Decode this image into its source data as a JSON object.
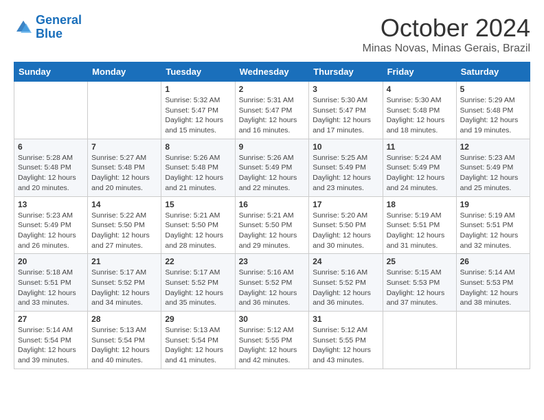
{
  "logo": {
    "line1": "General",
    "line2": "Blue"
  },
  "title": "October 2024",
  "subtitle": "Minas Novas, Minas Gerais, Brazil",
  "headers": [
    "Sunday",
    "Monday",
    "Tuesday",
    "Wednesday",
    "Thursday",
    "Friday",
    "Saturday"
  ],
  "weeks": [
    [
      {
        "day": "",
        "sunrise": "",
        "sunset": "",
        "daylight": ""
      },
      {
        "day": "",
        "sunrise": "",
        "sunset": "",
        "daylight": ""
      },
      {
        "day": "1",
        "sunrise": "Sunrise: 5:32 AM",
        "sunset": "Sunset: 5:47 PM",
        "daylight": "Daylight: 12 hours and 15 minutes."
      },
      {
        "day": "2",
        "sunrise": "Sunrise: 5:31 AM",
        "sunset": "Sunset: 5:47 PM",
        "daylight": "Daylight: 12 hours and 16 minutes."
      },
      {
        "day": "3",
        "sunrise": "Sunrise: 5:30 AM",
        "sunset": "Sunset: 5:47 PM",
        "daylight": "Daylight: 12 hours and 17 minutes."
      },
      {
        "day": "4",
        "sunrise": "Sunrise: 5:30 AM",
        "sunset": "Sunset: 5:48 PM",
        "daylight": "Daylight: 12 hours and 18 minutes."
      },
      {
        "day": "5",
        "sunrise": "Sunrise: 5:29 AM",
        "sunset": "Sunset: 5:48 PM",
        "daylight": "Daylight: 12 hours and 19 minutes."
      }
    ],
    [
      {
        "day": "6",
        "sunrise": "Sunrise: 5:28 AM",
        "sunset": "Sunset: 5:48 PM",
        "daylight": "Daylight: 12 hours and 20 minutes."
      },
      {
        "day": "7",
        "sunrise": "Sunrise: 5:27 AM",
        "sunset": "Sunset: 5:48 PM",
        "daylight": "Daylight: 12 hours and 20 minutes."
      },
      {
        "day": "8",
        "sunrise": "Sunrise: 5:26 AM",
        "sunset": "Sunset: 5:48 PM",
        "daylight": "Daylight: 12 hours and 21 minutes."
      },
      {
        "day": "9",
        "sunrise": "Sunrise: 5:26 AM",
        "sunset": "Sunset: 5:49 PM",
        "daylight": "Daylight: 12 hours and 22 minutes."
      },
      {
        "day": "10",
        "sunrise": "Sunrise: 5:25 AM",
        "sunset": "Sunset: 5:49 PM",
        "daylight": "Daylight: 12 hours and 23 minutes."
      },
      {
        "day": "11",
        "sunrise": "Sunrise: 5:24 AM",
        "sunset": "Sunset: 5:49 PM",
        "daylight": "Daylight: 12 hours and 24 minutes."
      },
      {
        "day": "12",
        "sunrise": "Sunrise: 5:23 AM",
        "sunset": "Sunset: 5:49 PM",
        "daylight": "Daylight: 12 hours and 25 minutes."
      }
    ],
    [
      {
        "day": "13",
        "sunrise": "Sunrise: 5:23 AM",
        "sunset": "Sunset: 5:49 PM",
        "daylight": "Daylight: 12 hours and 26 minutes."
      },
      {
        "day": "14",
        "sunrise": "Sunrise: 5:22 AM",
        "sunset": "Sunset: 5:50 PM",
        "daylight": "Daylight: 12 hours and 27 minutes."
      },
      {
        "day": "15",
        "sunrise": "Sunrise: 5:21 AM",
        "sunset": "Sunset: 5:50 PM",
        "daylight": "Daylight: 12 hours and 28 minutes."
      },
      {
        "day": "16",
        "sunrise": "Sunrise: 5:21 AM",
        "sunset": "Sunset: 5:50 PM",
        "daylight": "Daylight: 12 hours and 29 minutes."
      },
      {
        "day": "17",
        "sunrise": "Sunrise: 5:20 AM",
        "sunset": "Sunset: 5:50 PM",
        "daylight": "Daylight: 12 hours and 30 minutes."
      },
      {
        "day": "18",
        "sunrise": "Sunrise: 5:19 AM",
        "sunset": "Sunset: 5:51 PM",
        "daylight": "Daylight: 12 hours and 31 minutes."
      },
      {
        "day": "19",
        "sunrise": "Sunrise: 5:19 AM",
        "sunset": "Sunset: 5:51 PM",
        "daylight": "Daylight: 12 hours and 32 minutes."
      }
    ],
    [
      {
        "day": "20",
        "sunrise": "Sunrise: 5:18 AM",
        "sunset": "Sunset: 5:51 PM",
        "daylight": "Daylight: 12 hours and 33 minutes."
      },
      {
        "day": "21",
        "sunrise": "Sunrise: 5:17 AM",
        "sunset": "Sunset: 5:52 PM",
        "daylight": "Daylight: 12 hours and 34 minutes."
      },
      {
        "day": "22",
        "sunrise": "Sunrise: 5:17 AM",
        "sunset": "Sunset: 5:52 PM",
        "daylight": "Daylight: 12 hours and 35 minutes."
      },
      {
        "day": "23",
        "sunrise": "Sunrise: 5:16 AM",
        "sunset": "Sunset: 5:52 PM",
        "daylight": "Daylight: 12 hours and 36 minutes."
      },
      {
        "day": "24",
        "sunrise": "Sunrise: 5:16 AM",
        "sunset": "Sunset: 5:52 PM",
        "daylight": "Daylight: 12 hours and 36 minutes."
      },
      {
        "day": "25",
        "sunrise": "Sunrise: 5:15 AM",
        "sunset": "Sunset: 5:53 PM",
        "daylight": "Daylight: 12 hours and 37 minutes."
      },
      {
        "day": "26",
        "sunrise": "Sunrise: 5:14 AM",
        "sunset": "Sunset: 5:53 PM",
        "daylight": "Daylight: 12 hours and 38 minutes."
      }
    ],
    [
      {
        "day": "27",
        "sunrise": "Sunrise: 5:14 AM",
        "sunset": "Sunset: 5:54 PM",
        "daylight": "Daylight: 12 hours and 39 minutes."
      },
      {
        "day": "28",
        "sunrise": "Sunrise: 5:13 AM",
        "sunset": "Sunset: 5:54 PM",
        "daylight": "Daylight: 12 hours and 40 minutes."
      },
      {
        "day": "29",
        "sunrise": "Sunrise: 5:13 AM",
        "sunset": "Sunset: 5:54 PM",
        "daylight": "Daylight: 12 hours and 41 minutes."
      },
      {
        "day": "30",
        "sunrise": "Sunrise: 5:12 AM",
        "sunset": "Sunset: 5:55 PM",
        "daylight": "Daylight: 12 hours and 42 minutes."
      },
      {
        "day": "31",
        "sunrise": "Sunrise: 5:12 AM",
        "sunset": "Sunset: 5:55 PM",
        "daylight": "Daylight: 12 hours and 43 minutes."
      },
      {
        "day": "",
        "sunrise": "",
        "sunset": "",
        "daylight": ""
      },
      {
        "day": "",
        "sunrise": "",
        "sunset": "",
        "daylight": ""
      }
    ]
  ]
}
